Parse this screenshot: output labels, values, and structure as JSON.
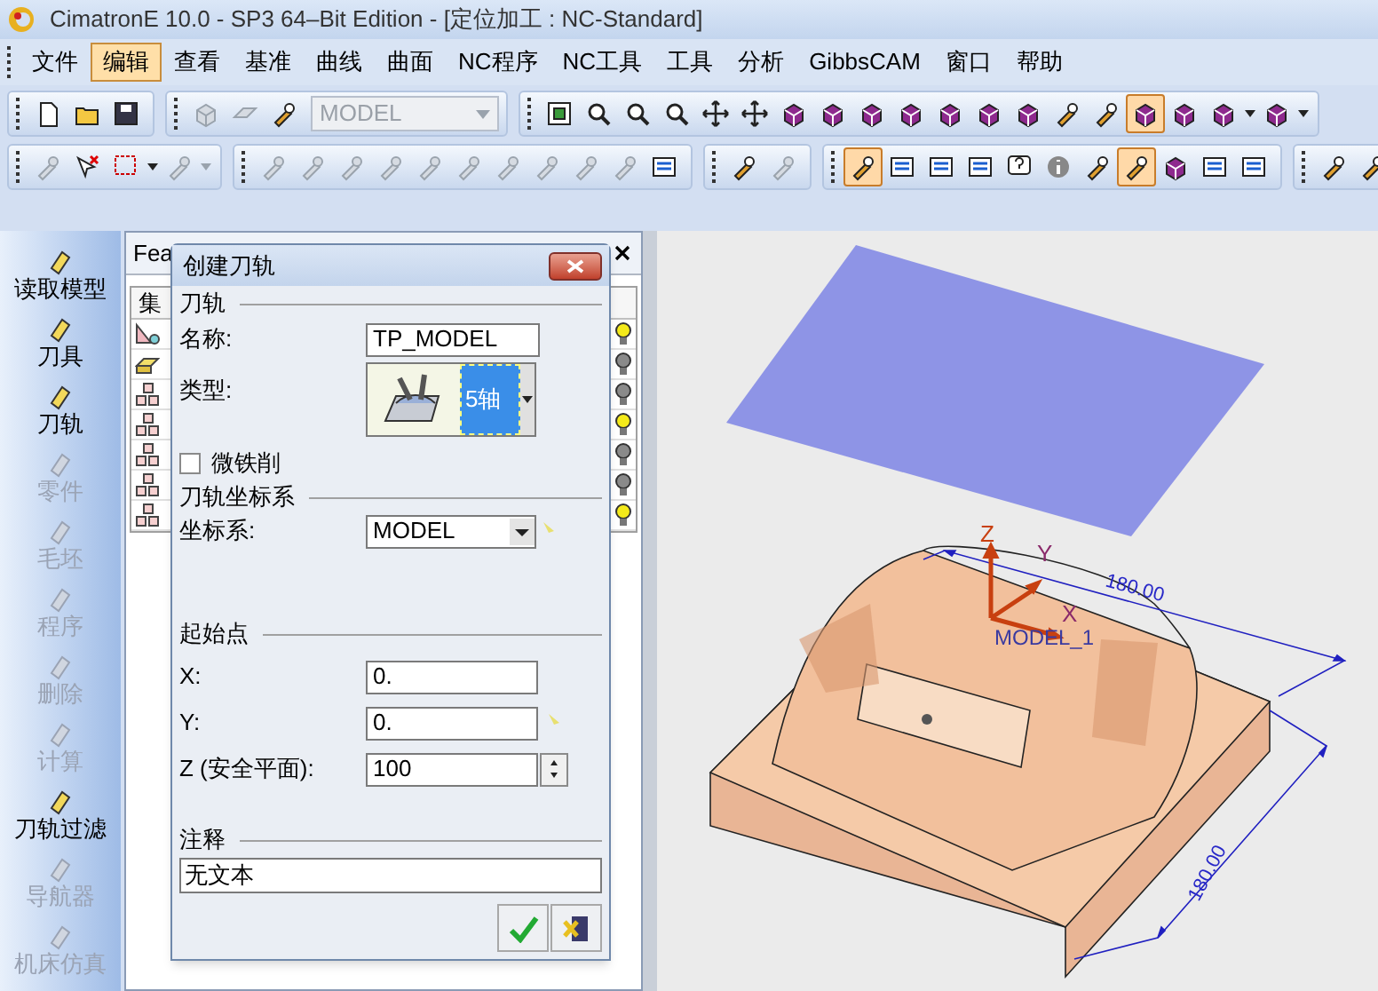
{
  "window": {
    "title": "CimatronE 10.0 - SP3 64–Bit Edition - [定位加工 : NC-Standard]"
  },
  "menu": [
    {
      "label": "文件",
      "selected": false
    },
    {
      "label": "编辑",
      "selected": true
    },
    {
      "label": "查看",
      "selected": false
    },
    {
      "label": "基准",
      "selected": false
    },
    {
      "label": "曲线",
      "selected": false
    },
    {
      "label": "曲面",
      "selected": false
    },
    {
      "label": "NC程序",
      "selected": false
    },
    {
      "label": "NC工具",
      "selected": false
    },
    {
      "label": "工具",
      "selected": false
    },
    {
      "label": "分析",
      "selected": false
    },
    {
      "label": "GibbsCAM",
      "selected": false
    },
    {
      "label": "窗口",
      "selected": false
    },
    {
      "label": "帮助",
      "selected": false
    }
  ],
  "toolbars": [
    {
      "groups": [
        {
          "items": [
            {
              "kind": "document",
              "disabled": false,
              "selected": false
            },
            {
              "kind": "folder",
              "disabled": false,
              "selected": false
            },
            {
              "kind": "disk",
              "disabled": false,
              "selected": false
            }
          ]
        },
        {
          "items": [
            {
              "kind": "cube",
              "disabled": true,
              "selected": false
            },
            {
              "kind": "plane",
              "disabled": true,
              "selected": false
            },
            {
              "kind": "tool",
              "disabled": false,
              "selected": false
            },
            {
              "kind": "combo",
              "value": "MODEL",
              "disabled": true
            }
          ]
        },
        {
          "items": [
            {
              "kind": "screen",
              "disabled": false,
              "selected": false
            },
            {
              "kind": "magnifier",
              "disabled": false,
              "selected": false
            },
            {
              "kind": "magnifier",
              "disabled": false,
              "selected": false
            },
            {
              "kind": "magnifier",
              "disabled": false,
              "selected": false
            },
            {
              "kind": "move",
              "disabled": false,
              "selected": false
            },
            {
              "kind": "move",
              "disabled": false,
              "selected": false
            },
            {
              "kind": "cube",
              "disabled": false,
              "selected": false
            },
            {
              "kind": "cube",
              "disabled": false,
              "selected": false
            },
            {
              "kind": "cube",
              "disabled": false,
              "selected": false
            },
            {
              "kind": "cube",
              "disabled": false,
              "selected": false
            },
            {
              "kind": "cube",
              "disabled": false,
              "selected": false
            },
            {
              "kind": "cube",
              "disabled": false,
              "selected": false
            },
            {
              "kind": "cube",
              "disabled": false,
              "selected": false
            },
            {
              "kind": "tool",
              "disabled": false,
              "selected": false
            },
            {
              "kind": "tool",
              "disabled": false,
              "selected": false
            },
            {
              "kind": "cube",
              "disabled": false,
              "selected": true
            },
            {
              "kind": "cube",
              "disabled": false,
              "selected": false
            },
            {
              "kind": "cube",
              "disabled": false,
              "selected": false,
              "caret": true
            },
            {
              "kind": "cube",
              "disabled": false,
              "selected": false,
              "caret": true
            }
          ]
        }
      ]
    },
    {
      "groups": [
        {
          "items": [
            {
              "kind": "tool",
              "disabled": true,
              "selected": false
            },
            {
              "kind": "delete",
              "disabled": false,
              "selected": false
            },
            {
              "kind": "select",
              "disabled": false,
              "selected": false,
              "caret": true
            },
            {
              "kind": "tool",
              "disabled": true,
              "selected": false,
              "caret": true
            }
          ]
        },
        {
          "items": [
            {
              "kind": "tool",
              "disabled": true,
              "selected": false
            },
            {
              "kind": "tool",
              "disabled": true,
              "selected": false
            },
            {
              "kind": "tool",
              "disabled": true,
              "selected": false
            },
            {
              "kind": "tool",
              "disabled": true,
              "selected": false
            },
            {
              "kind": "tool",
              "disabled": true,
              "selected": false
            },
            {
              "kind": "tool",
              "disabled": true,
              "selected": false
            },
            {
              "kind": "tool",
              "disabled": true,
              "selected": false
            },
            {
              "kind": "tool",
              "disabled": true,
              "selected": false
            },
            {
              "kind": "tool",
              "disabled": true,
              "selected": false
            },
            {
              "kind": "tool",
              "disabled": true,
              "selected": false
            },
            {
              "kind": "list",
              "disabled": false,
              "selected": false
            }
          ]
        },
        {
          "items": [
            {
              "kind": "tool",
              "disabled": false,
              "selected": false
            },
            {
              "kind": "tool",
              "disabled": true,
              "selected": false
            }
          ]
        },
        {
          "items": [
            {
              "kind": "tool",
              "disabled": false,
              "selected": true
            },
            {
              "kind": "list",
              "disabled": false,
              "selected": false
            },
            {
              "kind": "list",
              "disabled": false,
              "selected": false
            },
            {
              "kind": "list",
              "disabled": false,
              "selected": false
            },
            {
              "kind": "help",
              "disabled": false,
              "selected": false
            },
            {
              "kind": "info",
              "disabled": false,
              "selected": false
            },
            {
              "kind": "tool",
              "disabled": false,
              "selected": false
            },
            {
              "kind": "tool",
              "disabled": false,
              "selected": true
            },
            {
              "kind": "cube",
              "disabled": false,
              "selected": false
            },
            {
              "kind": "list",
              "disabled": false,
              "selected": false
            },
            {
              "kind": "list",
              "disabled": false,
              "selected": false
            }
          ]
        },
        {
          "items": [
            {
              "kind": "tool",
              "disabled": false,
              "selected": false
            },
            {
              "kind": "tool",
              "disabled": false,
              "selected": false
            }
          ]
        }
      ]
    }
  ],
  "sidebar": {
    "items": [
      {
        "label": "读取模型",
        "disabled": false
      },
      {
        "label": "刀具",
        "disabled": false
      },
      {
        "label": "刀轨",
        "disabled": false
      },
      {
        "label": "零件",
        "disabled": true
      },
      {
        "label": "毛坯",
        "disabled": true
      },
      {
        "label": "程序",
        "disabled": true
      },
      {
        "label": "删除",
        "disabled": true
      },
      {
        "label": "计算",
        "disabled": true
      },
      {
        "label": "刀轨过滤",
        "disabled": false
      },
      {
        "label": "导航器",
        "disabled": true
      },
      {
        "label": "机床仿真",
        "disabled": true
      }
    ]
  },
  "feature_panel": {
    "title": "Fea",
    "column_1": "集",
    "rows": [
      {
        "kind": "geometry",
        "on": true
      },
      {
        "kind": "stock",
        "on": false
      },
      {
        "kind": "tree",
        "on": false
      },
      {
        "kind": "tree",
        "on": true
      },
      {
        "kind": "tree",
        "on": false
      },
      {
        "kind": "tree",
        "on": false
      },
      {
        "kind": "tree",
        "on": true
      }
    ]
  },
  "dialog": {
    "title": "创建刀轨",
    "section_toolpath": "刀轨",
    "name_label": "名称:",
    "name_value": "TP_MODEL",
    "type_label": "类型:",
    "type_option": "5轴",
    "type_selected": true,
    "micro_label": "微铁削",
    "micro_checked": false,
    "section_ucs": "刀轨坐标系",
    "ucs_label": "坐标系:",
    "ucs_value": "MODEL",
    "section_start": "起始点",
    "x_label": "X:",
    "x_value": "0.",
    "y_label": "Y:",
    "y_value": "0.",
    "z_label": "Z (安全平面):",
    "z_value": "100",
    "section_comment": "注释",
    "comment_value": "无文本"
  },
  "viewport": {
    "axis_z": "Z",
    "axis_y": "Y",
    "axis_x": "X",
    "ucs_name": "MODEL_1",
    "dimension_1": "180.00",
    "dimension_2": "180.00"
  }
}
